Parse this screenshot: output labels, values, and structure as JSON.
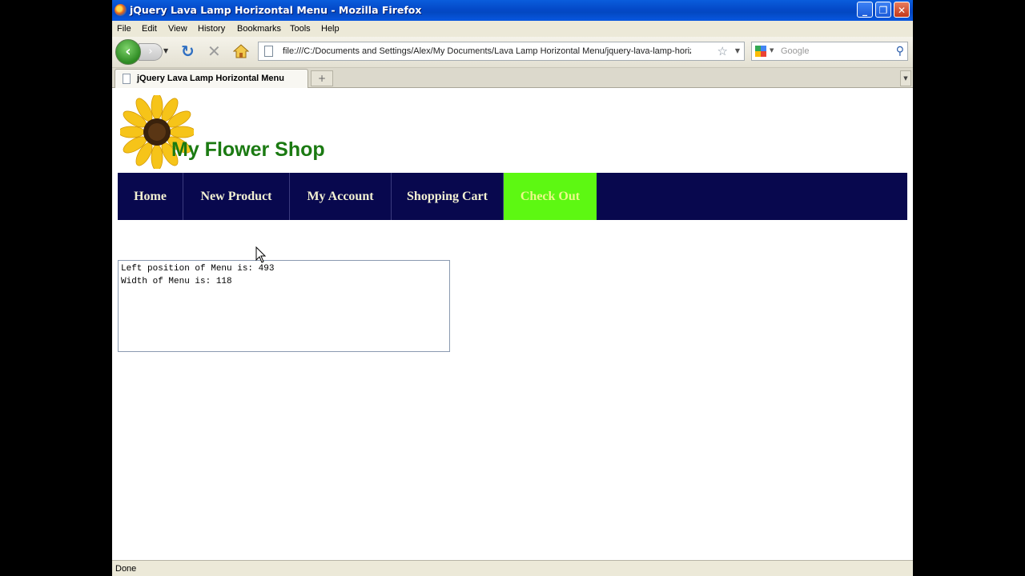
{
  "window": {
    "title": "jQuery Lava Lamp Horizontal Menu - Mozilla Firefox",
    "minimize": "_",
    "maximize": "❐",
    "close": "✕"
  },
  "menubar": [
    "File",
    "Edit",
    "View",
    "History",
    "Bookmarks",
    "Tools",
    "Help"
  ],
  "navbar": {
    "url": "file:///C:/Documents and Settings/Alex/My Documents/Lava Lamp Horizontal Menu/jquery-lava-lamp-horizontal-me",
    "search_placeholder": "Google"
  },
  "tabs": [
    {
      "label": "jQuery Lava Lamp Horizontal Menu",
      "active": true
    }
  ],
  "page": {
    "shop_title": "My Flower Shop",
    "menu": [
      "Home",
      "New Product",
      "My Account",
      "Shopping Cart",
      "Check Out"
    ],
    "highlighted_menu_item": "Check Out",
    "info_lines": [
      "Left position of Menu is: 493",
      "Width of Menu is: 118"
    ]
  },
  "status": "Done",
  "colors": {
    "menu_bg": "#08084e",
    "lava_highlight": "#5df812",
    "title_green": "#1b7a12"
  }
}
